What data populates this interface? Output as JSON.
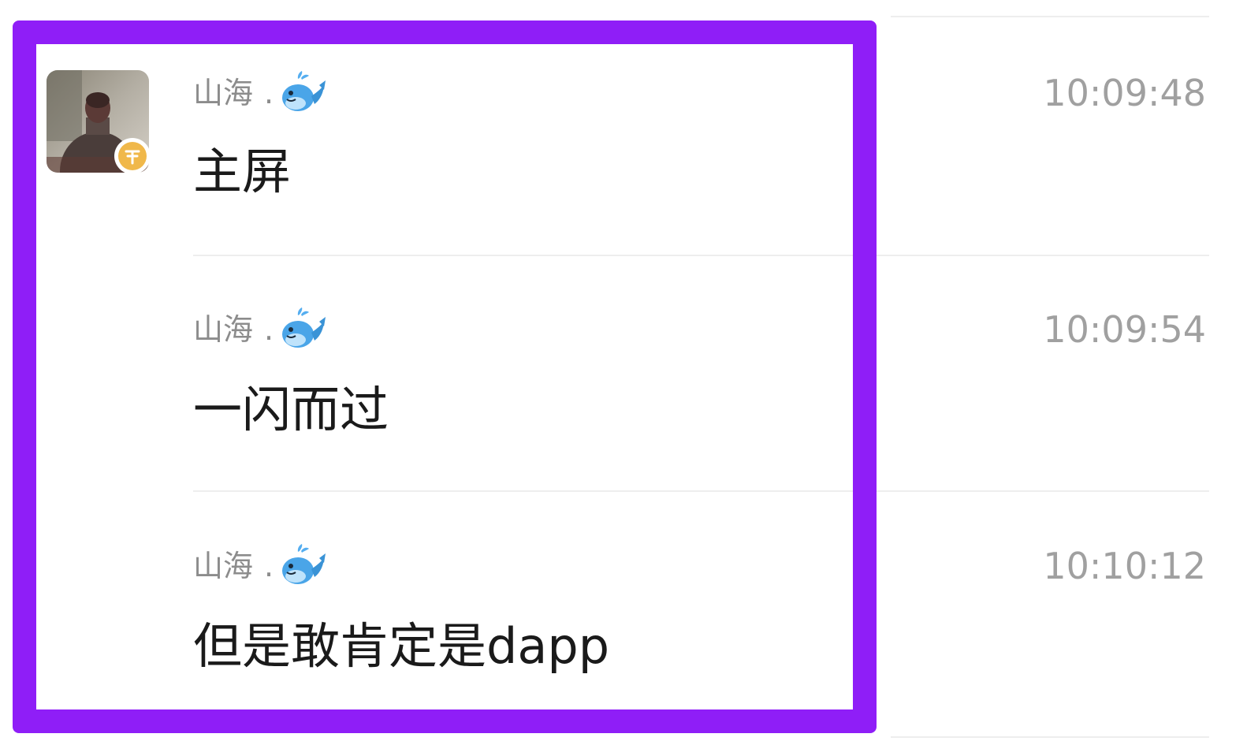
{
  "chat": {
    "messages": [
      {
        "sender": "山海",
        "sender_suffix": ".",
        "sender_icon": "whale-emoji",
        "time": "10:09:48",
        "text": "主屏",
        "show_avatar": true
      },
      {
        "sender": "山海",
        "sender_suffix": ".",
        "sender_icon": "whale-emoji",
        "time": "10:09:54",
        "text": "一闪而过",
        "show_avatar": false
      },
      {
        "sender": "山海",
        "sender_suffix": ".",
        "sender_icon": "whale-emoji",
        "time": "10:10:12",
        "text": "但是敢肯定是dapp",
        "show_avatar": false
      }
    ]
  },
  "colors": {
    "highlight": "#8f1ef7",
    "sender_name": "#8c8c8c",
    "timestamp": "#a0a0a0",
    "message_text": "#1a1a1a",
    "badge": "#f0b84a"
  }
}
